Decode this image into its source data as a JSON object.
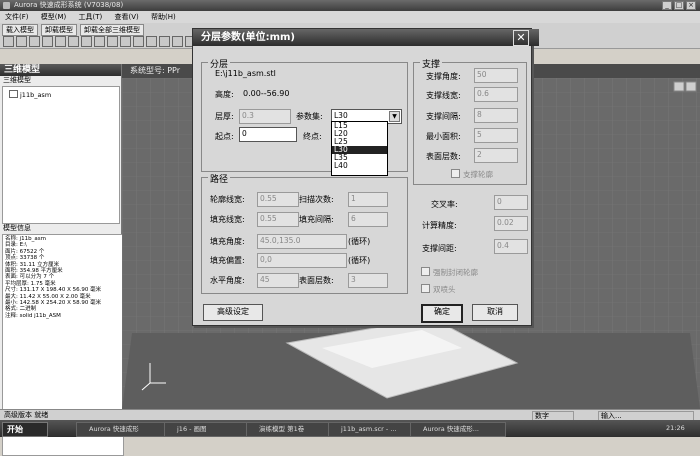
{
  "app": {
    "title": "Aurora 快速成形系统 (V7038/08)",
    "menu": [
      "文件(F)",
      "模型(M)",
      "工具(T)",
      "查看(V)",
      "帮助(H)"
    ],
    "toolbar_buttons": [
      "载入模型",
      "卸载模型",
      "卸载全部三维模型"
    ]
  },
  "left_panel": {
    "title": "三维模型",
    "tree_header": "三维模型",
    "tree_item": "j11b_asm",
    "info_header": "模型信息",
    "info_lines": [
      "名称: j11b_asm",
      "目录: E:\\",
      "面片: 67522 个",
      "顶点: 33738 个",
      "体积: 31.11 立方厘米",
      "面积: 354.98 平方厘米",
      "表面: 可以分为 7 个",
      "平均层厚: 1.75 毫米",
      "尺寸: 131.17 X 198.40 X 56.90 毫米",
      "最大: 11.42 X 55.00 X 2.00 毫米",
      "最小: 142.58 X 254.20 X 58.90 毫米",
      "格式: 二进制",
      "注释: solid j11b_ASM"
    ]
  },
  "viewport": {
    "header": "系统型号: PPr"
  },
  "dialog": {
    "title": "分层参数(单位:mm)",
    "close_glyph": "✕",
    "layering": {
      "group_title": "分层",
      "file": "E:\\j11b_asm.stl",
      "height_label": "高度:",
      "height_value": "0.00--56.90",
      "thickness_label": "层厚:",
      "thickness_value": "0.3",
      "param_label": "参数集:",
      "param_value": "L30",
      "start_label": "起点:",
      "start_value": "0",
      "end_label": "终点:",
      "param_options": [
        "L15",
        "L20",
        "L25",
        "L30",
        "L35",
        "L40"
      ],
      "param_selected_index": 3
    },
    "path": {
      "group_title": "路径",
      "contour_width_label": "轮廓线宽:",
      "contour_width_value": "0.55",
      "scan_count_label": "扫描次数:",
      "scan_count_value": "1",
      "fill_width_label": "填充线宽:",
      "fill_width_value": "0.55",
      "fill_interval_label": "填充间隔:",
      "fill_interval_value": "6",
      "fill_angle_label": "填充角度:",
      "fill_angle_value": "45.0,135.0",
      "fill_angle_suffix": "(循环)",
      "fill_offset_label": "填充偏置:",
      "fill_offset_value": "0,0",
      "fill_offset_suffix": "(循环)",
      "horiz_angle_label": "水平角度:",
      "horiz_angle_value": "45",
      "surface_layers_label": "表面层数:",
      "surface_layers_value": "3"
    },
    "support": {
      "group_title": "支撑",
      "angle_label": "支撑角度:",
      "angle_value": "50",
      "line_width_label": "支撑线宽:",
      "line_width_value": "0.6",
      "interval_label": "支撑间隔:",
      "interval_value": "8",
      "min_area_label": "最小面积:",
      "min_area_value": "5",
      "surface_layers_label": "表面层数:",
      "surface_layers_value": "2",
      "outline_label": "支撑轮廓"
    },
    "misc": {
      "cross_rate_label": "交叉率:",
      "cross_rate_value": "0",
      "precision_label": "计算精度:",
      "precision_value": "0.02",
      "support_gap_label": "支撑间距:",
      "support_gap_value": "0.4",
      "force_closed_label": "强制封闭轮廓",
      "dual_nozzle_label": "双喷头"
    },
    "buttons": {
      "advanced": "高级设定",
      "ok": "确定",
      "cancel": "取消"
    }
  },
  "statusbar": {
    "left": "高级版本 就绪",
    "num": "数字",
    "input": "输入..."
  },
  "taskbar": {
    "start": "开始",
    "items": [
      "Aurora 快速成形",
      "j16 - 画图",
      "演练模型 第1卷",
      "j11b_asm.scr - ...",
      "Aurora 快速成形..."
    ],
    "clock": "21:26"
  },
  "colors": {
    "titlebar": "#3d3d3d",
    "dialog_bg": "#d7d7d7",
    "viewport_bg": "#6a6a6a"
  }
}
